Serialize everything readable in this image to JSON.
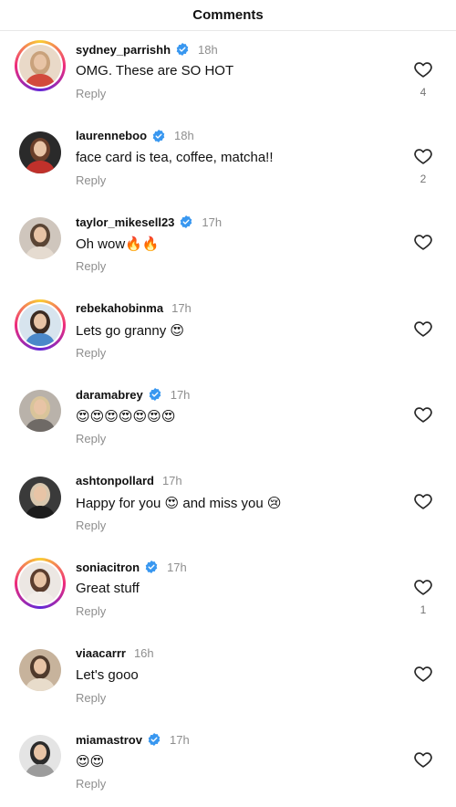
{
  "header": {
    "title": "Comments"
  },
  "comments": [
    {
      "username": "sydney_parrishh",
      "verified": true,
      "time": "18h",
      "text": "OMG. These are SO HOT",
      "reply_label": "Reply",
      "likes": "4",
      "story_ring": true,
      "avatar_colors": [
        "#e9d9c8",
        "#c9a27c",
        "#d24a3c"
      ]
    },
    {
      "username": "laurenneboo",
      "verified": true,
      "time": "18h",
      "text": "face card is tea, coffee, matcha!!",
      "reply_label": "Reply",
      "likes": "2",
      "story_ring": false,
      "avatar_colors": [
        "#2a2a2a",
        "#6b3f2a",
        "#c0312b"
      ]
    },
    {
      "username": "taylor_mikesell23",
      "verified": true,
      "time": "17h",
      "text": "Oh wow🔥🔥",
      "reply_label": "Reply",
      "likes": "",
      "story_ring": false,
      "avatar_colors": [
        "#cfc6bd",
        "#5a4535",
        "#e5dbd0"
      ]
    },
    {
      "username": "rebekahobinma",
      "verified": false,
      "time": "17h",
      "text": "Lets go granny 😍",
      "reply_label": "Reply",
      "likes": "",
      "story_ring": true,
      "avatar_colors": [
        "#d7e4ee",
        "#3b2b22",
        "#4a88c9"
      ]
    },
    {
      "username": "daramabrey",
      "verified": true,
      "time": "17h",
      "text": "😍😍😍😍😍😍😍",
      "reply_label": "Reply",
      "likes": "",
      "story_ring": false,
      "avatar_colors": [
        "#b9b2aa",
        "#d9c49a",
        "#6f6a66"
      ]
    },
    {
      "username": "ashtonpollard",
      "verified": false,
      "time": "17h",
      "text": "Happy for you 😍 and miss you 😢",
      "reply_label": "Reply",
      "likes": "",
      "story_ring": false,
      "avatar_colors": [
        "#3a3a3a",
        "#d8c7ae",
        "#1c1c1c"
      ]
    },
    {
      "username": "soniacitron",
      "verified": true,
      "time": "17h",
      "text": "Great stuff",
      "reply_label": "Reply",
      "likes": "1",
      "story_ring": true,
      "avatar_colors": [
        "#ece7e3",
        "#5b3d2e",
        "#f2ede9"
      ]
    },
    {
      "username": "viaacarrr",
      "verified": false,
      "time": "16h",
      "text": "Let's gooo",
      "reply_label": "Reply",
      "likes": "",
      "story_ring": false,
      "avatar_colors": [
        "#c7b39c",
        "#4f3a2c",
        "#e8dccb"
      ]
    },
    {
      "username": "miamastrov",
      "verified": true,
      "time": "17h",
      "text": "😍😍",
      "reply_label": "Reply",
      "likes": "",
      "story_ring": false,
      "avatar_colors": [
        "#e4e4e4",
        "#2b2b2b",
        "#9c9c9c"
      ]
    }
  ],
  "colors": {
    "verified": "#3897f0",
    "muted": "#8e8e8e",
    "story_ring": [
      "#f9ce34",
      "#ee2a7b",
      "#6228d7"
    ]
  },
  "icons": {
    "like": "heart-outline-icon",
    "verified": "verified-badge-icon"
  }
}
